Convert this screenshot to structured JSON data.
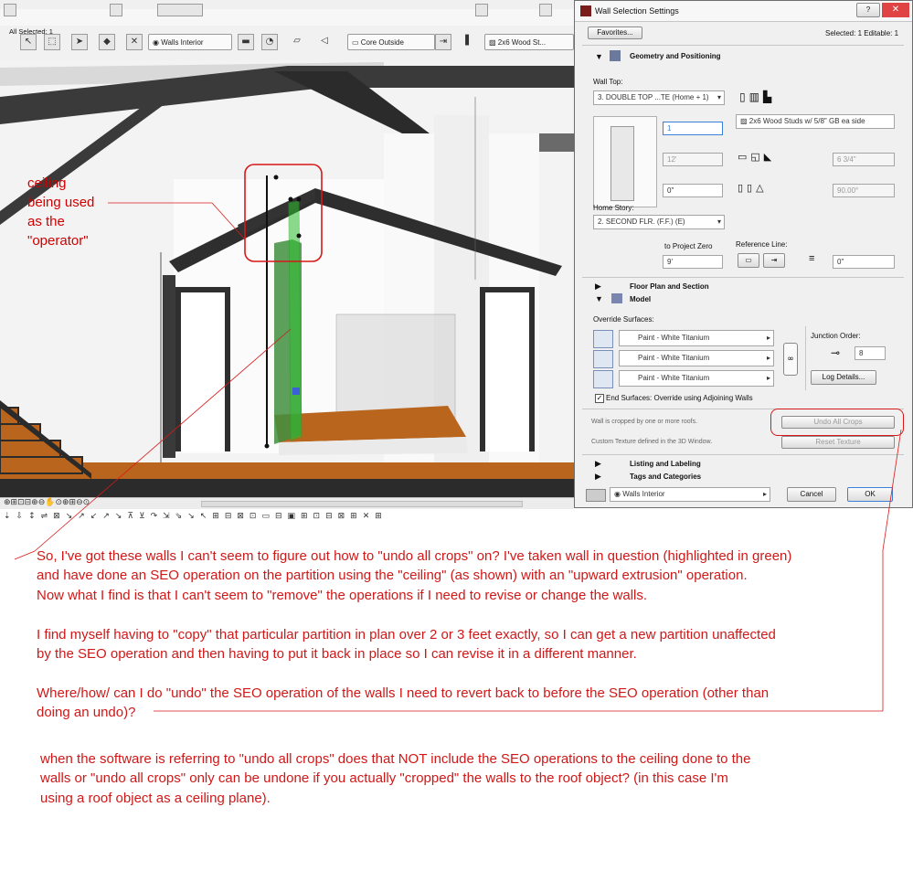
{
  "toolbar": {
    "selection_label": "All Selected: 1",
    "layer_combo": "Walls Interior",
    "composite_combo": "Core Outside",
    "material_combo": "2x6 Wood St..."
  },
  "dialog": {
    "title": "Wall Selection Settings",
    "favorites_button": "Favorites...",
    "selection_info": "Selected: 1 Editable: 1",
    "sections": {
      "geometry": "Geometry and Positioning",
      "floor_plan": "Floor Plan and Section",
      "model": "Model",
      "listing": "Listing and Labeling",
      "tags": "Tags and Categories"
    },
    "wall_top_label": "Wall Top:",
    "wall_top_value": "3. DOUBLE TOP ...TE (Home + 1)",
    "height_value": "1",
    "height_dim": "12'",
    "offset_value": "0\"",
    "home_story_label": "Home Story:",
    "home_story_value": "2. SECOND FLR. (F.F.) (E)",
    "to_project_zero_label": "to Project Zero",
    "project_zero_value": "9'",
    "structure_value": "2x6 Wood Studs w/ 5/8\" GB ea side",
    "thickness_value": "6 3/4\"",
    "angle_value": "90.00°",
    "reference_line_label": "Reference Line:",
    "ref_offset_value": "0\"",
    "override_surfaces_label": "Override Surfaces:",
    "surfaces": [
      "Paint - White Titanium",
      "Paint - White Titanium",
      "Paint - White Titanium"
    ],
    "junction_order_label": "Junction Order:",
    "junction_order_value": "8",
    "log_details_button": "Log Details...",
    "end_surfaces_label": "End Surfaces: Override using Adjoining Walls",
    "cropped_note": "Wall is cropped by one or more roofs.",
    "undo_all_crops_button": "Undo All Crops",
    "texture_note": "Custom Texture defined in the 3D Window.",
    "reset_texture_button": "Reset Texture",
    "bottom_layer_value": "Walls Interior",
    "cancel_button": "Cancel",
    "ok_button": "OK"
  },
  "callout": {
    "lines": [
      "ceiling",
      "being used",
      "as the",
      "\"operator\""
    ]
  },
  "annotation": {
    "lines": [
      "So, I've got these walls I can't seem to figure out how to \"undo all crops\" on? I've taken wall in question (highlighted in green)",
      "and have done an SEO operation on the partition using the \"ceiling\" (as shown) with an \"upward extrusion\" operation.",
      "Now what I find is that I can't seem to \"remove\" the operations if I need to revise or change the walls.",
      "",
      "I find myself having to \"copy\" that particular partition in plan over 2 or 3 feet exactly, so I can get a new partition unaffected",
      "by the SEO operation and then having to put it back in place so I can revise it in a different manner.",
      "",
      "Where/how/ can I do \"undo\" the SEO operation of the walls I need to revert back to before the SEO operation (other than",
      "doing an undo)?"
    ],
    "question_lines": [
      "when the software is referring to \"undo all crops\" does that NOT include the SEO operations to the ceiling done to the",
      "walls or \"undo all crops\" only can be undone if you actually \"cropped\" the walls to the roof object? (in this case I'm",
      "using a roof object as a ceiling plane)."
    ]
  },
  "colors": {
    "annotation_red": "#d01818",
    "highlight_green": "#2fbf2f",
    "floor_wood": "#b9651e",
    "dark_structure": "#2b2b2b"
  }
}
